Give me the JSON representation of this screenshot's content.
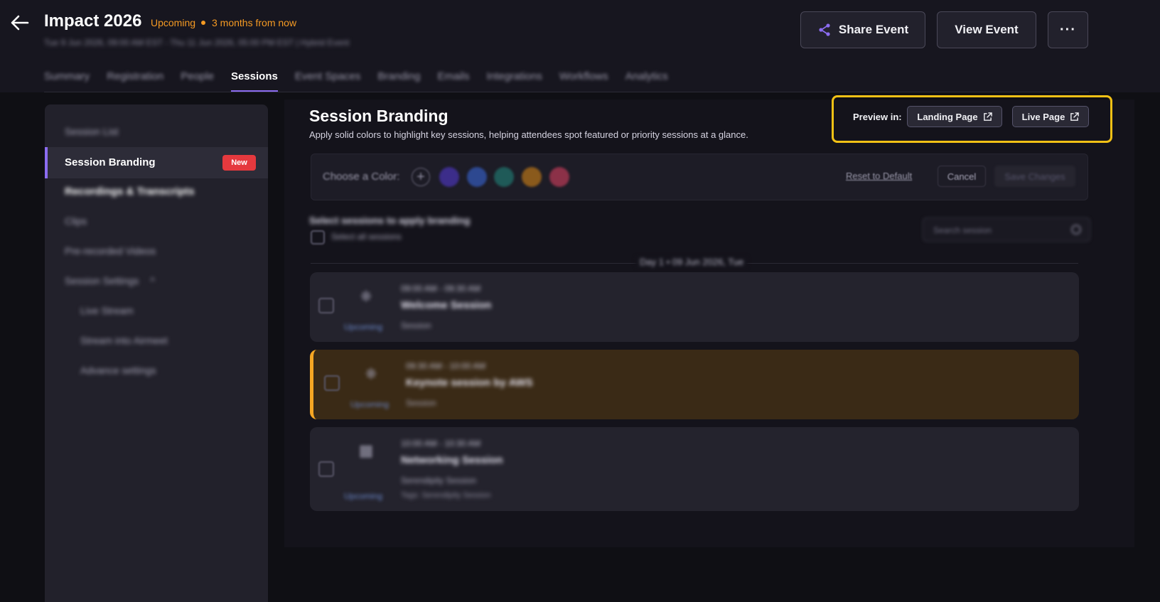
{
  "header": {
    "event_title": "Impact 2026",
    "status": "Upcoming",
    "relative_time": "3 months from now",
    "dateline": "Tue 9 Jun 2026, 09:00 AM EST - Thu 11 Jun 2026, 05:00 PM EST | Hybrid Event",
    "share_label": "Share Event",
    "view_label": "View Event",
    "more_label": "···"
  },
  "tabs": [
    "Summary",
    "Registration",
    "People",
    "Sessions",
    "Event Spaces",
    "Branding",
    "Emails",
    "Integrations",
    "Workflows",
    "Analytics"
  ],
  "sidebar": {
    "items": [
      {
        "label": "Session List"
      },
      {
        "label": "Session Branding",
        "badge": "New"
      },
      {
        "label": "Recordings & Transcripts"
      },
      {
        "label": "Clips"
      },
      {
        "label": "Pre-recorded Videos"
      },
      {
        "label": "Session Settings"
      },
      {
        "label": "Live Stream"
      },
      {
        "label": "Stream into Airmeet"
      },
      {
        "label": "Advance settings"
      }
    ]
  },
  "main": {
    "title": "Session Branding",
    "description": "Apply solid colors to highlight key sessions, helping attendees spot featured or priority sessions at a glance.",
    "preview_label": "Preview in:",
    "landing_page_label": "Landing Page",
    "live_page_label": "Live Page",
    "choose_color_label": "Choose a Color:",
    "reset_label": "Reset to Default",
    "cancel_label": "Cancel",
    "save_label": "Save Changes",
    "select_heading": "Select sessions to apply branding",
    "select_all_label": "Select all sessions",
    "search_placeholder": "Search session",
    "day_label": "Day 1 • 09 Jun 2026, Tue"
  },
  "swatches": [
    "#3c2d8a",
    "#2d4890",
    "#1f5a58",
    "#8a5a1c",
    "#8c3148"
  ],
  "sessions": [
    {
      "time": "09:00 AM - 09:30 AM",
      "name": "Welcome Session",
      "state": "Upcoming",
      "type": "Session",
      "tags": ""
    },
    {
      "time": "09:30 AM - 10:00 AM",
      "name": "Keynote session by AWS",
      "state": "Upcoming",
      "type": "Session",
      "tags": ""
    },
    {
      "time": "10:00 AM - 10:30 AM",
      "name": "Networking Session",
      "state": "Upcoming",
      "type": "Serendipity Session",
      "tags": "Tags: Serendipity Session"
    }
  ],
  "colors": {
    "accent": "#8b6cf0",
    "warning": "#f59a23",
    "highlight_outline": "#f2c115",
    "badge": "#e5393e"
  }
}
